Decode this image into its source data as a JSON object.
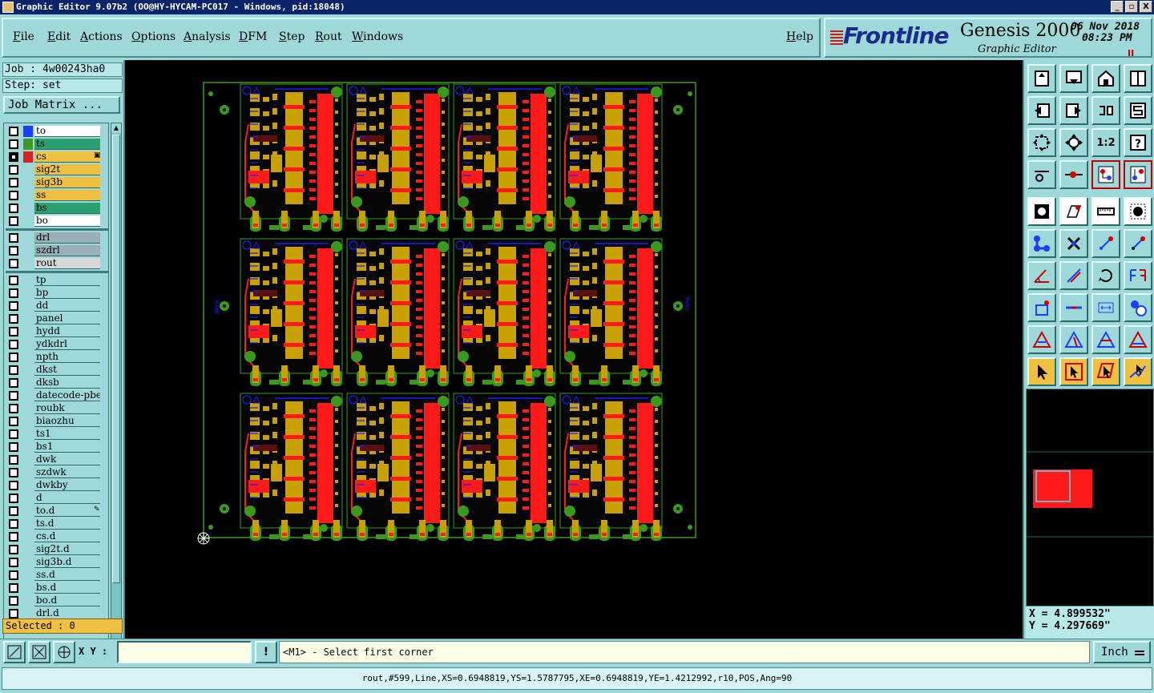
{
  "window": {
    "title": "Graphic Editor 9.07b2 (OO@HY-HYCAM-PC017 - Windows, pid:18048)",
    "buttons": [
      "_",
      "▫",
      "X"
    ]
  },
  "menu": [
    {
      "label": "File"
    },
    {
      "label": "Edit"
    },
    {
      "label": "Actions"
    },
    {
      "label": "Options"
    },
    {
      "label": "Analysis"
    },
    {
      "label": "DFM"
    },
    {
      "label": "Step"
    },
    {
      "label": "Rout"
    },
    {
      "label": "Windows"
    },
    {
      "label": "Help"
    }
  ],
  "brand": {
    "logo": "Frontline",
    "product": "Genesis 2000",
    "subtitle": "Graphic Editor",
    "date": "06 Nov 2018",
    "time": "08:23 PM",
    "pause": "II"
  },
  "job": {
    "job_text": "Job : 4w00243ha0",
    "step_text": "Step: set",
    "matrix_button": "Job Matrix ...",
    "selected": "Selected : 0"
  },
  "layers": [
    {
      "name": "to",
      "color": "#ffffff",
      "swatch": "#1c3cff",
      "mark": ""
    },
    {
      "name": "ts",
      "color": "#2aa070",
      "swatch": "#3a9a2a",
      "mark": ""
    },
    {
      "name": "cs",
      "color": "#f0c040",
      "swatch": "#e02020",
      "mark": "▣",
      "active": true
    },
    {
      "name": "sig2t",
      "color": "#f0c040",
      "swatch": "",
      "mark": ""
    },
    {
      "name": "sig3b",
      "color": "#f0c040",
      "swatch": "",
      "mark": ""
    },
    {
      "name": "ss",
      "color": "#f0c040",
      "swatch": "",
      "mark": ""
    },
    {
      "name": "bs",
      "color": "#2aa070",
      "swatch": "",
      "mark": ""
    },
    {
      "name": "bo",
      "color": "#ffffff",
      "swatch": "",
      "mark": ""
    },
    {
      "name": "drl",
      "color": "#9ab0b8",
      "swatch": "",
      "mark": "",
      "group": 2
    },
    {
      "name": "szdrl",
      "color": "#9ab0b8",
      "swatch": "",
      "mark": "",
      "group": 2
    },
    {
      "name": "rout",
      "color": "#d8d8d8",
      "swatch": "",
      "mark": "",
      "group": 2
    },
    {
      "name": "tp",
      "color": "#9fd8d8",
      "swatch": "",
      "mark": "",
      "group": 3
    },
    {
      "name": "bp",
      "color": "#9fd8d8",
      "swatch": "",
      "mark": "",
      "group": 3
    },
    {
      "name": "dd",
      "color": "#9fd8d8",
      "swatch": "",
      "mark": "",
      "group": 3
    },
    {
      "name": "panel",
      "color": "#9fd8d8",
      "swatch": "",
      "mark": "",
      "group": 3
    },
    {
      "name": "hydd",
      "color": "#9fd8d8",
      "swatch": "",
      "mark": "",
      "group": 3
    },
    {
      "name": "ydkdrl",
      "color": "#9fd8d8",
      "swatch": "",
      "mark": "",
      "group": 3
    },
    {
      "name": "npth",
      "color": "#9fd8d8",
      "swatch": "",
      "mark": "",
      "group": 3
    },
    {
      "name": "dkst",
      "color": "#9fd8d8",
      "swatch": "",
      "mark": "",
      "group": 3
    },
    {
      "name": "dksb",
      "color": "#9fd8d8",
      "swatch": "",
      "mark": "",
      "group": 3
    },
    {
      "name": "datecode-pbe",
      "color": "#9fd8d8",
      "swatch": "",
      "mark": "",
      "group": 3
    },
    {
      "name": "roubk",
      "color": "#9fd8d8",
      "swatch": "",
      "mark": "",
      "group": 3
    },
    {
      "name": "biaozhu",
      "color": "#9fd8d8",
      "swatch": "",
      "mark": "",
      "group": 3
    },
    {
      "name": "ts1",
      "color": "#9fd8d8",
      "swatch": "",
      "mark": "",
      "group": 3
    },
    {
      "name": "bs1",
      "color": "#9fd8d8",
      "swatch": "",
      "mark": "",
      "group": 3
    },
    {
      "name": "dwk",
      "color": "#9fd8d8",
      "swatch": "",
      "mark": "",
      "group": 3
    },
    {
      "name": "szdwk",
      "color": "#9fd8d8",
      "swatch": "",
      "mark": "",
      "group": 3
    },
    {
      "name": "dwkby",
      "color": "#9fd8d8",
      "swatch": "",
      "mark": "",
      "group": 3
    },
    {
      "name": "d",
      "color": "#9fd8d8",
      "swatch": "",
      "mark": "",
      "group": 3
    },
    {
      "name": "to.d",
      "color": "#9fd8d8",
      "swatch": "",
      "mark": "✎",
      "group": 3
    },
    {
      "name": "ts.d",
      "color": "#9fd8d8",
      "swatch": "",
      "mark": "",
      "group": 3
    },
    {
      "name": "cs.d",
      "color": "#9fd8d8",
      "swatch": "",
      "mark": "",
      "group": 3
    },
    {
      "name": "sig2t.d",
      "color": "#9fd8d8",
      "swatch": "",
      "mark": "",
      "group": 3
    },
    {
      "name": "sig3b.d",
      "color": "#9fd8d8",
      "swatch": "",
      "mark": "",
      "group": 3
    },
    {
      "name": "ss.d",
      "color": "#9fd8d8",
      "swatch": "",
      "mark": "",
      "group": 3
    },
    {
      "name": "bs.d",
      "color": "#9fd8d8",
      "swatch": "",
      "mark": "",
      "group": 3
    },
    {
      "name": "bo.d",
      "color": "#9fd8d8",
      "swatch": "",
      "mark": "",
      "group": 3
    },
    {
      "name": "drl.d",
      "color": "#9fd8d8",
      "swatch": "",
      "mark": "",
      "group": 3
    }
  ],
  "toolbar_icons": [
    "home-top-icon",
    "download-icon",
    "house-icon",
    "window-split-icon",
    "import-icon",
    "export-icon",
    "mirror-icon",
    "s-curve-icon",
    "fit-icon",
    "center-icon",
    "ratio-icon",
    "help-icon",
    "brush-icon",
    "probe-icon",
    "pads-red-icon",
    "pads-select-icon",
    "snap-icon",
    "measure-shape-icon",
    "ruler-icon",
    "pad-icon",
    "connect-icon",
    "cross-icon",
    "move-point-icon",
    "move-point-2-icon",
    "angle-icon",
    "line-icon",
    "rotate-icon",
    "flip-icon",
    "node-icon",
    "split-icon",
    "dimension-icon",
    "circles-icon",
    "triangle-a-icon",
    "triangle-b-icon",
    "triangle-c-icon",
    "triangle-d-icon",
    "pointer-icon",
    "pointer-box-icon",
    "pointer-shape-icon",
    "pointer-path-icon"
  ],
  "ratio_label": "1:2",
  "coords": {
    "x": "X = 4.899532\"",
    "y": "Y = 4.297669\""
  },
  "bottom": {
    "xy_label": "X Y :",
    "xy_value": "",
    "prompt": "<M1> - Select first corner",
    "units": "Inch"
  },
  "status": "rout,#599,Line,XS=0.6948819,YS=1.5787795,XE=0.6948819,YE=1.4212992,r10,POS,Ang=90",
  "board": {
    "rows": 3,
    "cols": 4,
    "side_label": "M4NG"
  }
}
